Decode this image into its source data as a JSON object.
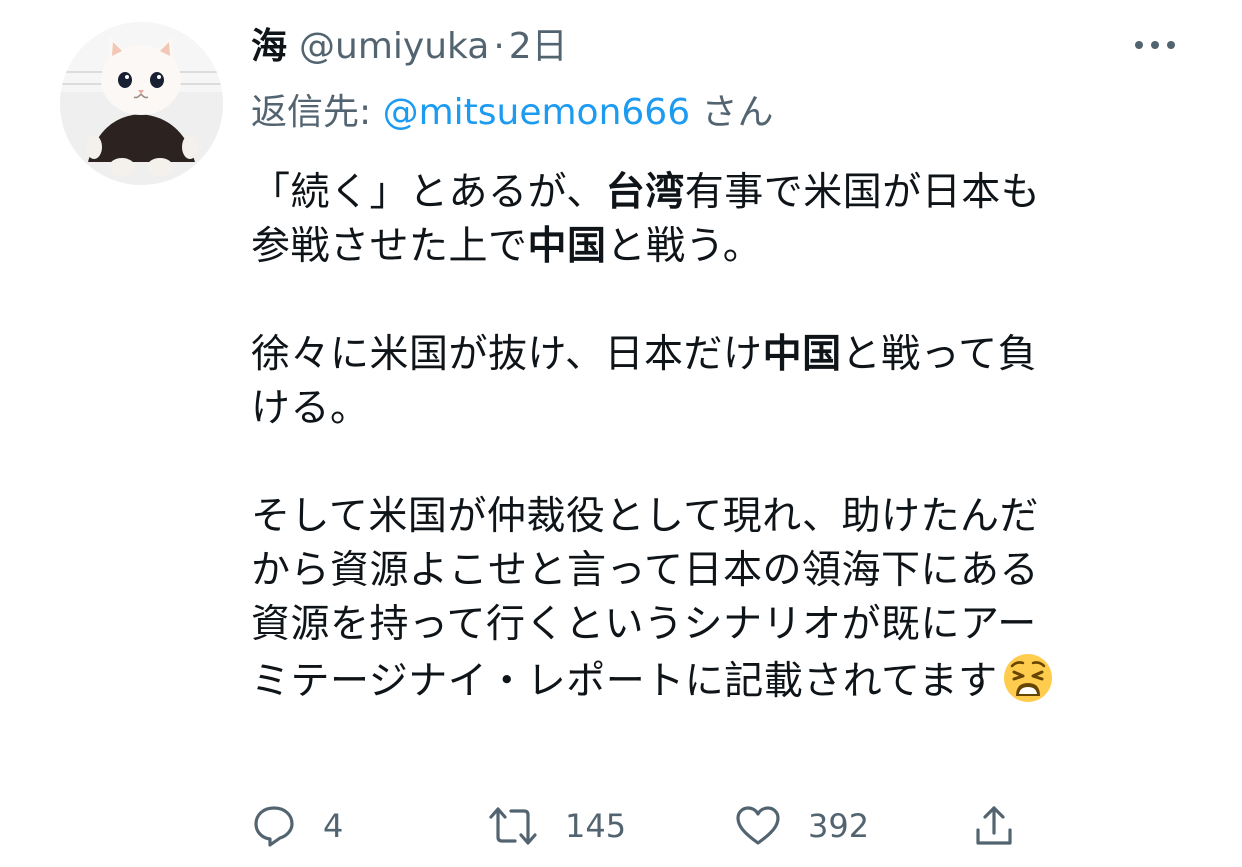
{
  "tweet": {
    "display_name": "海",
    "handle": "@umiyuka",
    "separator": "·",
    "time": "2日",
    "reply_prefix": "返信先: ",
    "reply_mention": "@mitsuemon666",
    "reply_suffix": " さん",
    "body": {
      "p1": {
        "l1a": "「続く」とあるが、",
        "l1b": "台湾",
        "l1c": "有事で米国が日本も",
        "l2a": "参戦させた上で",
        "l2b": "中国",
        "l2c": "と戦う。"
      },
      "p2": {
        "l1a": "徐々に米国が抜け、日本だけ",
        "l1b": "中国",
        "l1c": "と戦って負",
        "l2": "ける。"
      },
      "p3": {
        "l1": "そして米国が仲裁役として現れ、助けたんだ",
        "l2": "から資源よこせと言って日本の領海下にある",
        "l3": "資源を持って行くというシナリオが既にアー",
        "l4": "ミテージナイ・レポートに記載されてます"
      }
    },
    "emoji_icon": "weary-face-emoji",
    "actions": {
      "reply_count": "4",
      "retweet_count": "145",
      "like_count": "392"
    }
  }
}
